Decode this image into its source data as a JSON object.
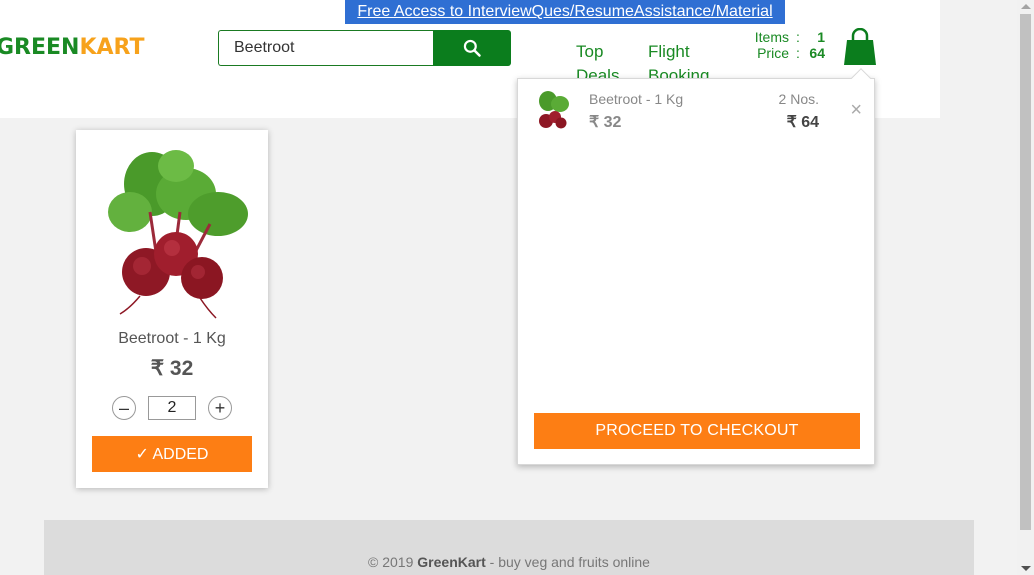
{
  "header": {
    "promo_link": "Free Access to InterviewQues/ResumeAssistance/Material",
    "brand_part1": "GREEN",
    "brand_part2": "KART",
    "search": {
      "value": "Beetroot"
    },
    "nav": [
      {
        "label": "Top\nDeals"
      },
      {
        "label": "Flight\nBooking"
      }
    ],
    "cart_info": {
      "items_label": "Items",
      "items_value": "1",
      "price_label": "Price",
      "price_value": "64",
      "separator": ":"
    }
  },
  "cart_preview": {
    "items": [
      {
        "name": "Beetroot - 1 Kg",
        "price": "₹ 32",
        "quantity": "2 Nos.",
        "amount": "₹ 64",
        "remove": "×"
      }
    ],
    "checkout_label": "PROCEED TO CHECKOUT"
  },
  "product": {
    "name": "Beetroot - 1 Kg",
    "price": "₹ 32",
    "decrement": "–",
    "increment": "+",
    "quantity": "2",
    "added_label": "✓ ADDED"
  },
  "footer": {
    "copyright": "© 2019 ",
    "brand": "GreenKart",
    "tagline": " - buy veg and fruits online"
  },
  "colors": {
    "brand_green": "#1a8a24",
    "brand_orange": "#f7a21b",
    "accent_orange": "#fd7e14",
    "promo_blue": "#2f6fd3"
  }
}
